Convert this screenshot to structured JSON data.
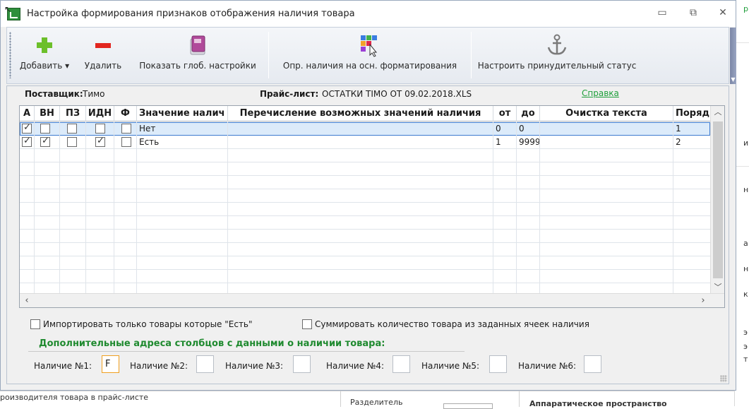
{
  "window": {
    "title": "Настройка формирования признаков отображения наличия товара",
    "minimize_glyph": "▭",
    "maximize_glyph": "⧉",
    "close_glyph": "✕"
  },
  "toolbar": {
    "add_label": "Добавить ▾",
    "delete_label": "Удалить",
    "global_settings_label": "Показать глоб. настройки",
    "detect_availability_label": "Опр. наличия на осн. форматирования",
    "force_status_label": "Настроить принудительный статус"
  },
  "info": {
    "supplier_label": "Поставщик:",
    "supplier_value": "Тимо",
    "pricelist_label": "Прайс-лист:",
    "pricelist_value": "ОСТАТКИ TIMO ОТ 09.02.2018.XLS",
    "help_link": "Справка"
  },
  "grid": {
    "columns": [
      "А",
      "ВН",
      "ПЗ",
      "ИДН",
      "Ф",
      "Значение налич",
      "Перечисление возможных значений наличия",
      "от",
      "до",
      "Очистка текста",
      "Поряд"
    ],
    "rows": [
      {
        "a": true,
        "vn": false,
        "pz": false,
        "idn": false,
        "f": false,
        "value": "Нет",
        "enum": "",
        "from": "0",
        "to": "0",
        "clean": "",
        "order": "1"
      },
      {
        "a": true,
        "vn": true,
        "pz": false,
        "idn": true,
        "f": false,
        "value": "Есть",
        "enum": "",
        "from": "1",
        "to": "9999",
        "clean": "",
        "order": "2"
      }
    ],
    "selected_row": 0
  },
  "options": {
    "import_only_available": "Импортировать только товары которые \"Есть\"",
    "sum_quantity": "Суммировать количество товара из заданных ячеек наличия",
    "import_only_available_checked": false,
    "sum_quantity_checked": false
  },
  "extra": {
    "title": "Дополнительные адреса столбцов с данными о наличии товара:",
    "fields": [
      {
        "label": "Наличие №1:",
        "value": "F"
      },
      {
        "label": "Наличие №2:",
        "value": ""
      },
      {
        "label": "Наличие №3:",
        "value": ""
      },
      {
        "label": "Наличие №4:",
        "value": ""
      },
      {
        "label": "Наличие №5:",
        "value": ""
      },
      {
        "label": "Наличие №6:",
        "value": ""
      }
    ]
  },
  "background": {
    "bottom_left_text": "роизводителя товара в прайс-листе",
    "bottom_mid_text": "Разделитель",
    "bottom_right_text": "Аппаратическое пространство",
    "right_fragments": [
      "р",
      "и",
      "н",
      "а",
      "н",
      "к",
      "э",
      "э",
      "т"
    ]
  },
  "colors": {
    "accent_green": "#1f8a2f",
    "selection_bg": "#dcebfa",
    "selection_border": "#3d7bd0",
    "focus_border": "#f0a020"
  }
}
